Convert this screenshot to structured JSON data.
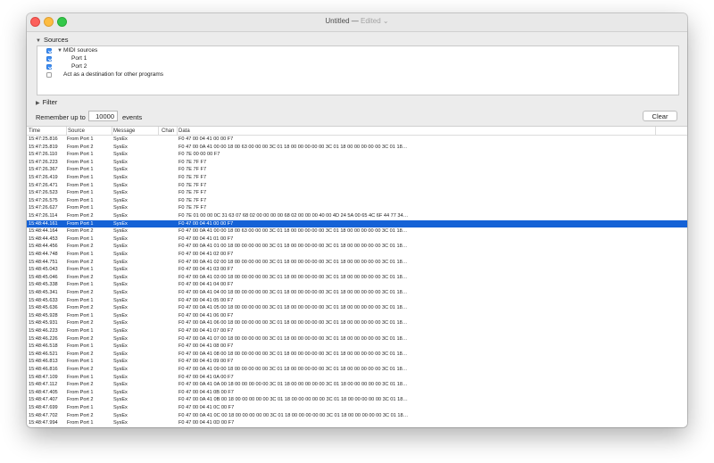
{
  "window": {
    "title": "Untitled",
    "title_sep": "—",
    "status": "Edited",
    "status_chevron": "⌄"
  },
  "sources_section": {
    "label": "Sources",
    "midi_label": "MIDI sources",
    "ports": [
      {
        "label": "Port 1",
        "checked": true
      },
      {
        "label": "Port 2",
        "checked": true
      }
    ],
    "destination_label": "Act as a destination for other programs",
    "destination_checked": false
  },
  "filter_section": {
    "label": "Filter"
  },
  "remember": {
    "prefix": "Remember up to",
    "value": "10000",
    "suffix": "events"
  },
  "clear_label": "Clear",
  "table": {
    "columns": [
      "Time",
      "Source",
      "Message",
      "Chan",
      "Data"
    ],
    "selected_index": 11,
    "rows": [
      [
        "15:47:25.816",
        "From Port 1",
        "SysEx",
        "F0 47 00 04 41 00 00 F7"
      ],
      [
        "15:47:25.819",
        "From Port 2",
        "SysEx",
        "F0 47 00 0A 41 00 00 18 00 63 00 00 00 3C 01 18 00 00 00 00 00 3C 01 18 00 00 00 00 00 3C 01 18…"
      ],
      [
        "15:47:26.110",
        "From Port 1",
        "SysEx",
        "F0 7E 00 00 00 F7"
      ],
      [
        "15:47:26.223",
        "From Port 1",
        "SysEx",
        "F0 7E 7F F7"
      ],
      [
        "15:47:26.367",
        "From Port 1",
        "SysEx",
        "F0 7E 7F F7"
      ],
      [
        "15:47:26.419",
        "From Port 1",
        "SysEx",
        "F0 7E 7F F7"
      ],
      [
        "15:47:26.471",
        "From Port 1",
        "SysEx",
        "F0 7E 7F F7"
      ],
      [
        "15:47:26.523",
        "From Port 1",
        "SysEx",
        "F0 7E 7F F7"
      ],
      [
        "15:47:26.575",
        "From Port 1",
        "SysEx",
        "F0 7E 7F F7"
      ],
      [
        "15:47:26.627",
        "From Port 1",
        "SysEx",
        "F0 7E 7F F7"
      ],
      [
        "15:47:26.114",
        "From Port 2",
        "SysEx",
        "F0 7E 01 00 00 0C 31 63 07 68 02 00 00 00 00 68 02 00 00 00 40 00 4D 24 5A 00 65 4C 6F 44 77 34…"
      ],
      [
        "15:48:44.161",
        "From Port 1",
        "SysEx",
        "F0 47 00 04 41 00 00 F7"
      ],
      [
        "15:48:44.164",
        "From Port 2",
        "SysEx",
        "F0 47 00 0A 41 00 00 18 00 63 00 00 00 3C 01 18 00 00 00 00 00 3C 01 18 00 00 00 00 00 3C 01 18…"
      ],
      [
        "15:48:44.453",
        "From Port 1",
        "SysEx",
        "F0 47 00 04 41 01 00 F7"
      ],
      [
        "15:48:44.456",
        "From Port 2",
        "SysEx",
        "F0 47 00 0A 41 01 00 18 00 00 00 00 00 3C 01 18 00 00 00 00 00 3C 01 18 00 00 00 00 00 3C 01 18…"
      ],
      [
        "15:48:44.748",
        "From Port 1",
        "SysEx",
        "F0 47 00 04 41 02 00 F7"
      ],
      [
        "15:48:44.751",
        "From Port 2",
        "SysEx",
        "F0 47 00 0A 41 02 00 18 00 00 00 00 00 3C 01 18 00 00 00 00 00 3C 01 18 00 00 00 00 00 3C 01 18…"
      ],
      [
        "15:48:45.043",
        "From Port 1",
        "SysEx",
        "F0 47 00 04 41 03 00 F7"
      ],
      [
        "15:48:45.046",
        "From Port 2",
        "SysEx",
        "F0 47 00 0A 41 03 00 18 00 00 00 00 00 3C 01 18 00 00 00 00 00 3C 01 18 00 00 00 00 00 3C 01 18…"
      ],
      [
        "15:48:45.338",
        "From Port 1",
        "SysEx",
        "F0 47 00 04 41 04 00 F7"
      ],
      [
        "15:48:45.341",
        "From Port 2",
        "SysEx",
        "F0 47 00 0A 41 04 00 18 00 00 00 00 00 3C 01 18 00 00 00 00 00 3C 01 18 00 00 00 00 00 3C 01 18…"
      ],
      [
        "15:48:45.633",
        "From Port 1",
        "SysEx",
        "F0 47 00 04 41 05 00 F7"
      ],
      [
        "15:48:45.636",
        "From Port 2",
        "SysEx",
        "F0 47 00 0A 41 05 00 18 00 00 00 00 00 3C 01 18 00 00 00 00 00 3C 01 18 00 00 00 00 00 3C 01 18…"
      ],
      [
        "15:48:45.928",
        "From Port 1",
        "SysEx",
        "F0 47 00 04 41 06 00 F7"
      ],
      [
        "15:48:45.931",
        "From Port 2",
        "SysEx",
        "F0 47 00 0A 41 06 00 18 00 00 00 00 00 3C 01 18 00 00 00 00 00 3C 01 18 00 00 00 00 00 3C 01 18…"
      ],
      [
        "15:48:46.223",
        "From Port 1",
        "SysEx",
        "F0 47 00 04 41 07 00 F7"
      ],
      [
        "15:48:46.226",
        "From Port 2",
        "SysEx",
        "F0 47 00 0A 41 07 00 18 00 00 00 00 00 3C 01 18 00 00 00 00 00 3C 01 18 00 00 00 00 00 3C 01 18…"
      ],
      [
        "15:48:46.518",
        "From Port 1",
        "SysEx",
        "F0 47 00 04 41 08 00 F7"
      ],
      [
        "15:48:46.521",
        "From Port 2",
        "SysEx",
        "F0 47 00 0A 41 08 00 18 00 00 00 00 00 3C 01 18 00 00 00 00 00 3C 01 18 00 00 00 00 00 3C 01 18…"
      ],
      [
        "15:48:46.813",
        "From Port 1",
        "SysEx",
        "F0 47 00 04 41 09 00 F7"
      ],
      [
        "15:48:46.816",
        "From Port 2",
        "SysEx",
        "F0 47 00 0A 41 09 00 18 00 00 00 00 00 3C 01 18 00 00 00 00 00 3C 01 18 00 00 00 00 00 3C 01 18…"
      ],
      [
        "15:48:47.109",
        "From Port 1",
        "SysEx",
        "F0 47 00 04 41 0A 00 F7"
      ],
      [
        "15:48:47.112",
        "From Port 2",
        "SysEx",
        "F0 47 00 0A 41 0A 00 18 00 00 00 00 00 3C 01 18 00 00 00 00 00 3C 01 18 00 00 00 00 00 3C 01 18…"
      ],
      [
        "15:48:47.405",
        "From Port 1",
        "SysEx",
        "F0 47 00 04 41 0B 00 F7"
      ],
      [
        "15:48:47.407",
        "From Port 2",
        "SysEx",
        "F0 47 00 0A 41 0B 00 18 00 00 00 00 00 3C 01 18 00 00 00 00 00 3C 01 18 00 00 00 00 00 3C 01 18…"
      ],
      [
        "15:48:47.699",
        "From Port 1",
        "SysEx",
        "F0 47 00 04 41 0C 00 F7"
      ],
      [
        "15:48:47.702",
        "From Port 2",
        "SysEx",
        "F0 47 00 0A 41 0C 00 18 00 00 00 00 00 3C 01 18 00 00 00 00 00 3C 01 18 00 00 00 00 00 3C 01 18…"
      ],
      [
        "15:48:47.994",
        "From Port 1",
        "SysEx",
        "F0 47 00 04 41 0D 00 F7"
      ]
    ]
  }
}
